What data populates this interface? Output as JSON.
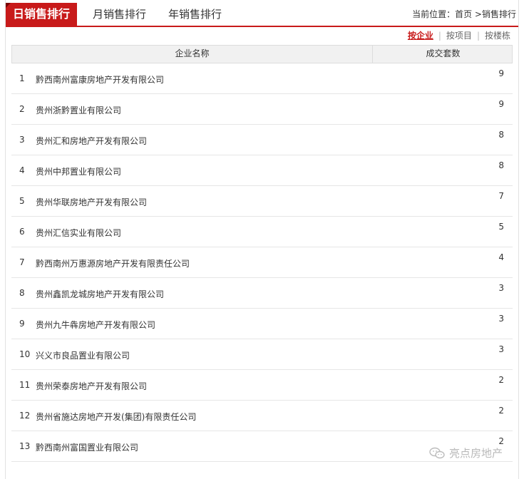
{
  "tabs": [
    {
      "label": "日销售排行",
      "active": true
    },
    {
      "label": "月销售排行",
      "active": false
    },
    {
      "label": "年销售排行",
      "active": false
    }
  ],
  "breadcrumb": {
    "prefix": "当前位置：",
    "home": "首页",
    "separator": " >",
    "current": "销售排行"
  },
  "sort_options": {
    "by_company": "按企业",
    "by_project": "按项目",
    "by_building": "按楼栋",
    "separator": "|"
  },
  "table": {
    "headers": {
      "name": "企业名称",
      "count": "成交套数"
    },
    "rows": [
      {
        "idx": "1",
        "name": "黔西南州富康房地产开发有限公司",
        "count": "9"
      },
      {
        "idx": "2",
        "name": "贵州浙黔置业有限公司",
        "count": "9"
      },
      {
        "idx": "3",
        "name": "贵州汇和房地产开发有限公司",
        "count": "8"
      },
      {
        "idx": "4",
        "name": "贵州中邦置业有限公司",
        "count": "8"
      },
      {
        "idx": "5",
        "name": "贵州华联房地产开发有限公司",
        "count": "7"
      },
      {
        "idx": "6",
        "name": "贵州汇信实业有限公司",
        "count": "5"
      },
      {
        "idx": "7",
        "name": "黔西南州万惠源房地产开发有限责任公司",
        "count": "4"
      },
      {
        "idx": "8",
        "name": "贵州鑫凯龙城房地产开发有限公司",
        "count": "3"
      },
      {
        "idx": "9",
        "name": "贵州九牛犇房地产开发有限公司",
        "count": "3"
      },
      {
        "idx": "10",
        "name": "兴义市良品置业有限公司",
        "count": "3"
      },
      {
        "idx": "11",
        "name": "贵州荣泰房地产开发有限公司",
        "count": "2"
      },
      {
        "idx": "12",
        "name": "贵州省施达房地产开发(集团)有限责任公司",
        "count": "2"
      },
      {
        "idx": "13",
        "name": "黔西南州富国置业有限公司",
        "count": "2"
      }
    ]
  },
  "watermark": {
    "text": "亮点房地产",
    "icon": "wechat-icon"
  },
  "colors": {
    "accent": "#c81a1a",
    "header_bg": "#f1f1f1"
  }
}
